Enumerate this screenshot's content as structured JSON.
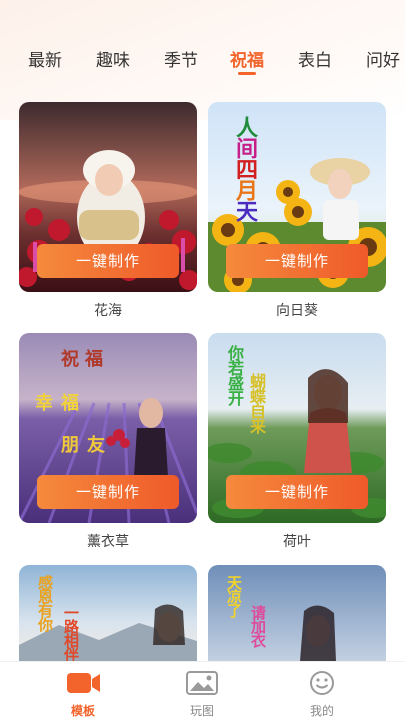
{
  "tabs": [
    "最新",
    "趣味",
    "季节",
    "祝福",
    "表白",
    "问好"
  ],
  "active_tab": "祝福",
  "cards": [
    {
      "title": "花海",
      "button": "一键制作"
    },
    {
      "title": "向日葵",
      "button": "一键制作",
      "art_text": [
        "人",
        "间",
        "四",
        "月",
        "天"
      ]
    },
    {
      "title": "薰衣草",
      "button": "一键制作",
      "art_text": [
        "祝福",
        "幸福",
        "朋友"
      ]
    },
    {
      "title": "荷叶",
      "button": "一键制作",
      "art_text": [
        "你若盛开",
        "蝴蝶自来"
      ]
    },
    {
      "art_text": [
        "感恩有你",
        "一路相伴"
      ]
    },
    {
      "art_text": [
        "天凉了",
        "请加衣"
      ]
    }
  ],
  "bottom_nav": [
    {
      "label": "模板",
      "icon": "video-camera-icon"
    },
    {
      "label": "玩图",
      "icon": "image-icon"
    },
    {
      "label": "我的",
      "icon": "smiley-face-icon"
    }
  ]
}
